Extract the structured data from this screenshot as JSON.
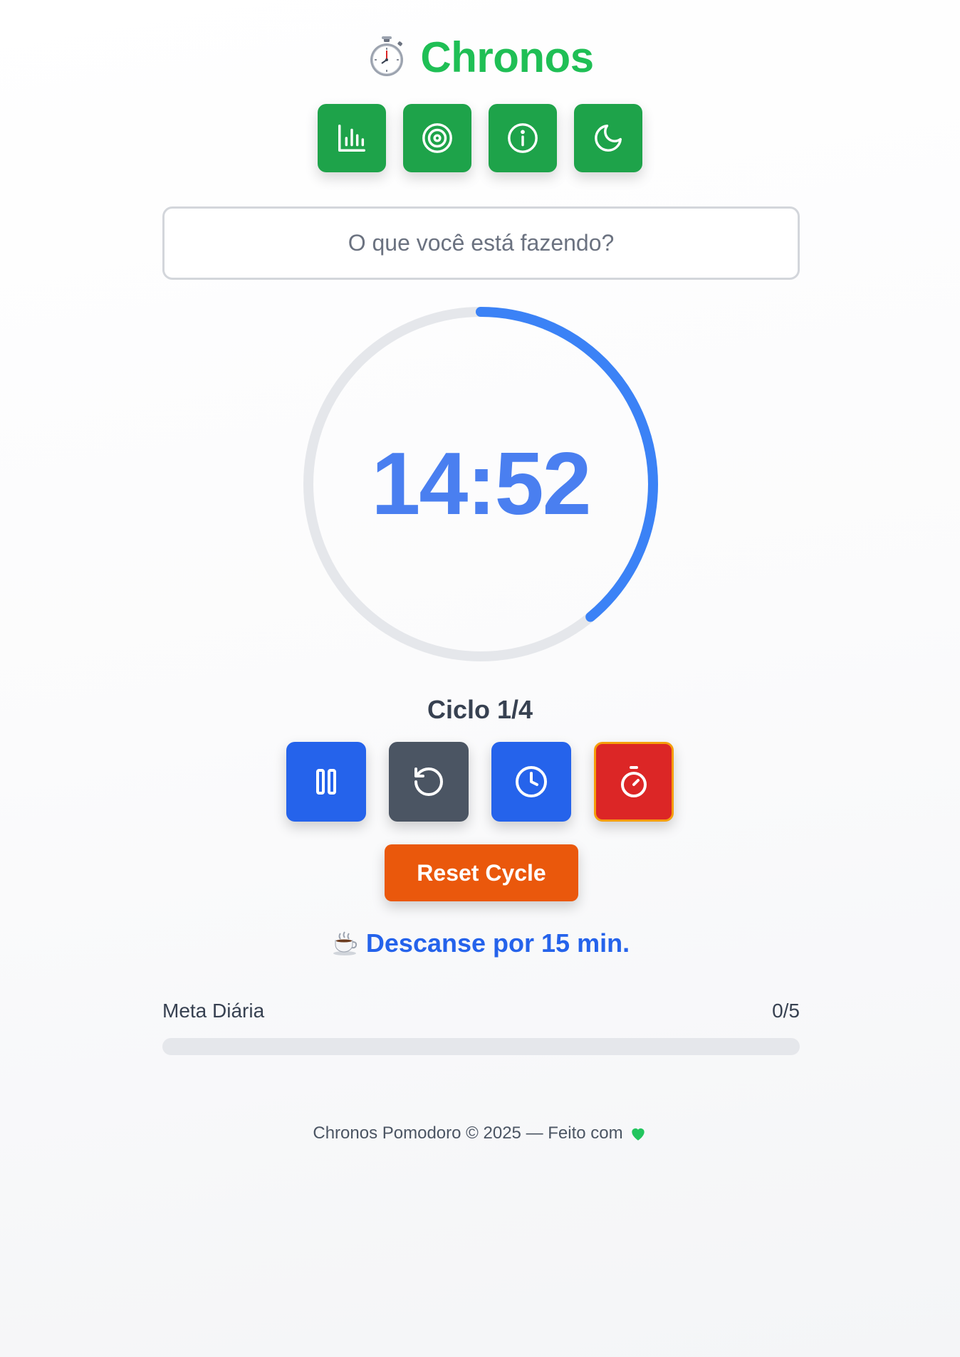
{
  "app": {
    "title": "Chronos",
    "logo_icon": "stopwatch-icon"
  },
  "top_actions": [
    {
      "name": "stats-button",
      "icon": "bar-chart-icon"
    },
    {
      "name": "goals-button",
      "icon": "target-icon"
    },
    {
      "name": "info-button",
      "icon": "info-icon"
    },
    {
      "name": "theme-toggle-button",
      "icon": "moon-icon"
    }
  ],
  "task": {
    "placeholder": "O que você está fazendo?",
    "value": ""
  },
  "timer": {
    "display": "14:52",
    "progress_fraction": 0.39,
    "ring_color": "#3b82f6",
    "track_color": "#e5e7eb"
  },
  "cycle": {
    "label": "Ciclo 1/4"
  },
  "controls": [
    {
      "name": "pause-button",
      "icon": "pause-icon",
      "color": "#2563eb"
    },
    {
      "name": "restart-button",
      "icon": "rotate-ccw-icon",
      "color": "#4b5563"
    },
    {
      "name": "clock-button",
      "icon": "clock-icon",
      "color": "#2563eb"
    },
    {
      "name": "timer-mode-button",
      "icon": "timer-icon",
      "color": "#dc2626"
    }
  ],
  "reset": {
    "label": "Reset Cycle",
    "color": "#ea580c"
  },
  "break_message": {
    "icon": "coffee-icon",
    "text": "Descanse por 15 min."
  },
  "daily_goal": {
    "label": "Meta Diária",
    "count": "0/5",
    "progress_fraction": 0
  },
  "footer": {
    "text": "Chronos Pomodoro © 2025 — Feito com",
    "icon": "green-heart-icon"
  },
  "colors": {
    "brand_green": "#1fbf55",
    "button_green": "#1ea34a",
    "timer_blue": "#4a7ff0"
  }
}
